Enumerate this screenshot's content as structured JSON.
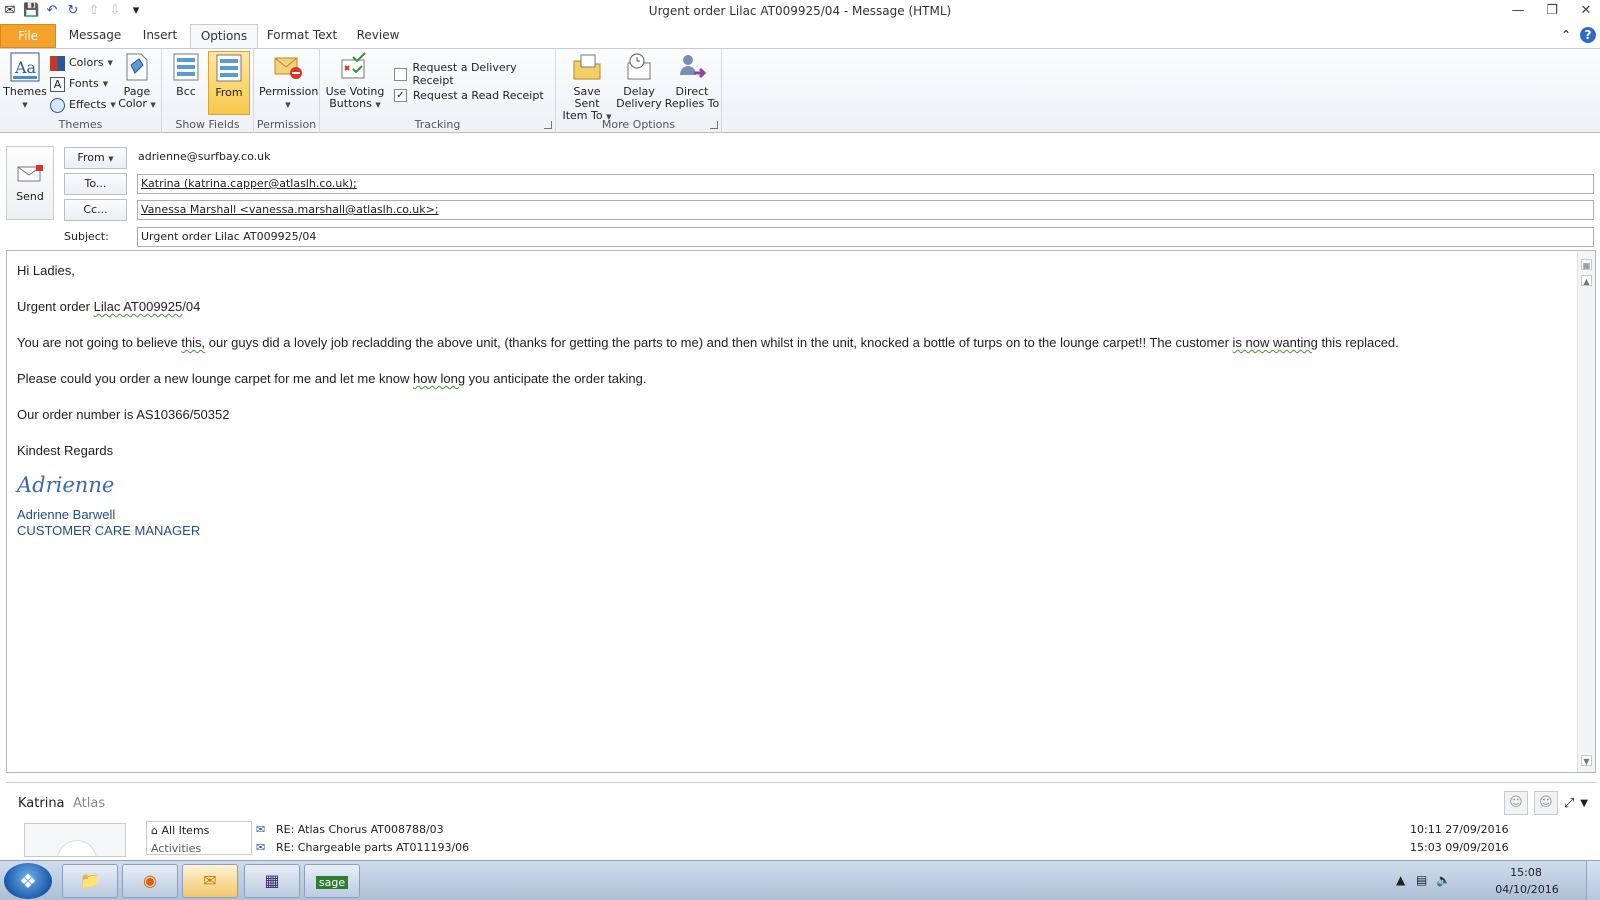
{
  "window": {
    "title": "Urgent order Lilac  AT009925/04  -  Message (HTML)"
  },
  "ribbon_tabs": [
    "File",
    "Message",
    "Insert",
    "Options",
    "Format Text",
    "Review"
  ],
  "active_tab": "Options",
  "ribbon": {
    "themes_group": {
      "label": "Themes",
      "themes": "Themes",
      "colors": "Colors",
      "fonts": "Fonts",
      "effects": "Effects",
      "page_color_1": "Page",
      "page_color_2": "Color"
    },
    "show_fields_group": {
      "label": "Show Fields",
      "bcc": "Bcc",
      "from": "From"
    },
    "permission_group": {
      "label": "Permission",
      "permission": "Permission"
    },
    "tracking_group": {
      "label": "Tracking",
      "voting_1": "Use Voting",
      "voting_2": "Buttons",
      "delivery_receipt": "Request a Delivery Receipt",
      "delivery_receipt_checked": false,
      "read_receipt": "Request a Read Receipt",
      "read_receipt_checked": true
    },
    "more_options_group": {
      "label": "More Options",
      "save_sent_1": "Save Sent",
      "save_sent_2": "Item To",
      "delay_1": "Delay",
      "delay_2": "Delivery",
      "direct_1": "Direct",
      "direct_2": "Replies To"
    }
  },
  "compose": {
    "send_label": "Send",
    "from_button": "From",
    "from_value": "adrienne@surfbay.co.uk",
    "to_button": "To...",
    "to_value": "Katrina (katrina.capper@atlaslh.co.uk);",
    "cc_button": "Cc...",
    "cc_value": "Vanessa Marshall <vanessa.marshall@atlaslh.co.uk>;",
    "subject_label": "Subject:",
    "subject_value": "Urgent order Lilac  AT009925/04"
  },
  "body": {
    "greeting": "Hi Ladies,",
    "line_order_prefix": "Urgent order ",
    "line_order_sq": "Lilac  AT009925",
    "line_order_suffix": "/04",
    "para1_a": "You are not going to believe ",
    "para1_sq1": "this,",
    "para1_b": " our guys did a lovely job recladding the above unit, (thanks for getting the parts to me) and then whilst in the unit, knocked a bottle of turps on to the lounge carpet!!  The customer ",
    "para1_sq2": "is now wanting",
    "para1_c": " this replaced.",
    "para2_a": "Please could you order a new lounge carpet for me and let me know ",
    "para2_sq": "how  long",
    "para2_b": " you anticipate the order taking.",
    "order_number": "Our order number is AS10366/50352",
    "closing": "Kindest Regards",
    "signature_script": "Adrienne",
    "signature_name": "Adrienne Barwell",
    "signature_title": "CUSTOMER CARE MANAGER"
  },
  "people_pane": {
    "name": "Katrina",
    "company": "Atlas",
    "filters": [
      "All Items",
      "Activities"
    ],
    "activities": [
      {
        "subject": "RE: Atlas Chorus AT008788/03",
        "date": "10:11  27/09/2016"
      },
      {
        "subject": "RE: Chargeable parts AT011193/06",
        "date": "15:03  09/09/2016"
      }
    ]
  },
  "taskbar": {
    "apps": [
      "windows-explorer",
      "firefox",
      "outlook",
      "calendar-app",
      "sage"
    ],
    "time": "15:08",
    "date": "04/10/2016"
  },
  "colors": {
    "file_tab": "#f4a22b",
    "pressed_button": "#f8c84b",
    "signature_blue": "#1f4e8a",
    "taskbar": "#bccbe0"
  }
}
